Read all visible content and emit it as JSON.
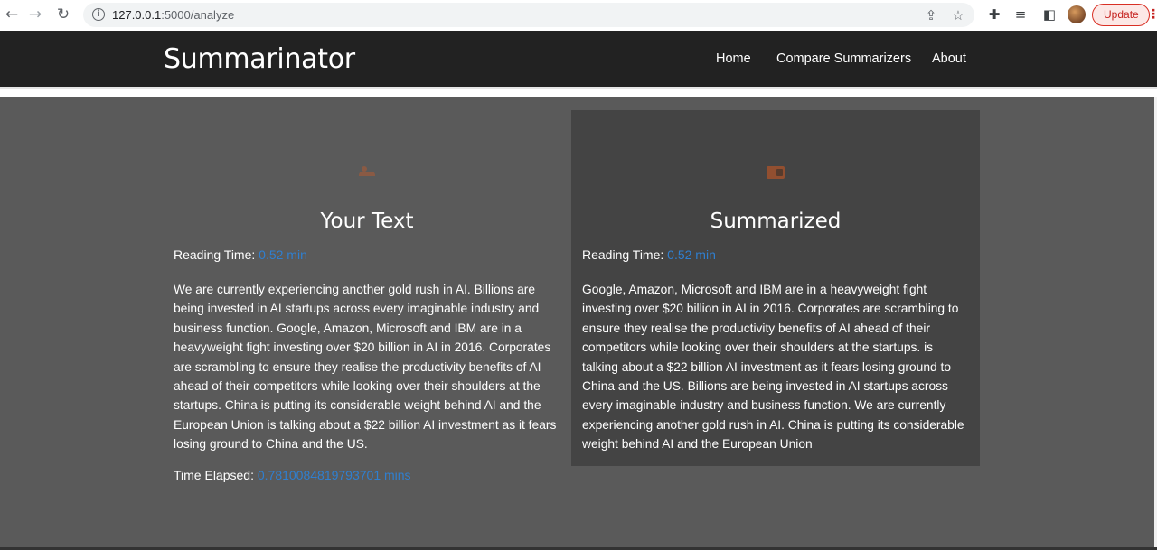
{
  "browser": {
    "url_host": "127.0.0.1",
    "url_path": ":5000/analyze",
    "update_label": "Update"
  },
  "navbar": {
    "brand": "Summarinator",
    "links": [
      "Home",
      "Compare Summarizers",
      "About"
    ]
  },
  "original": {
    "title": "Your Text",
    "reading_label": "Reading Time:",
    "reading_value": "0.52 min",
    "text": "We are currently experiencing another gold rush in AI. Billions are being invested in AI startups across every imaginable industry and business function. Google, Amazon, Microsoft and IBM are in a heavyweight fight investing over $20 billion in AI in 2016. Corporates are scrambling to ensure they realise the productivity benefits of AI ahead of their competitors while looking over their shoulders at the startups. China is putting its considerable weight behind AI and the European Union is talking about a $22 billion AI investment as it fears losing ground to China and the US.",
    "elapsed_label": "Time Elapsed:",
    "elapsed_value": "0.7810084819793701 mins"
  },
  "summary": {
    "title": "Summarized",
    "reading_label": "Reading Time:",
    "reading_value": "0.52 min",
    "text": "Google, Amazon, Microsoft and IBM are in a heavyweight fight investing over $20 billion in AI in 2016. Corporates are scrambling to ensure they realise the productivity benefits of AI ahead of their competitors while looking over their shoulders at the startups. is talking about a $22 billion AI investment as it fears losing ground to China and the US. Billions are being invested in AI startups across every imaginable industry and business function. We are currently experiencing another gold rush in AI. China is putting its considerable weight behind AI and the European Union"
  },
  "icons": {
    "back": "back-arrow-icon",
    "forward": "forward-arrow-icon",
    "reload": "reload-icon",
    "info": "info-icon",
    "share": "share-icon",
    "bookmark": "star-icon",
    "extensions": "puzzle-icon",
    "reading_list": "reading-list-icon",
    "side_panel": "side-panel-icon",
    "menu": "kebab-menu-icon"
  },
  "colors": {
    "accent_blue": "#2f7fd0",
    "navbar_bg": "#222222",
    "page_bg": "#5a5a5a",
    "summary_panel_bg": "#444444"
  }
}
